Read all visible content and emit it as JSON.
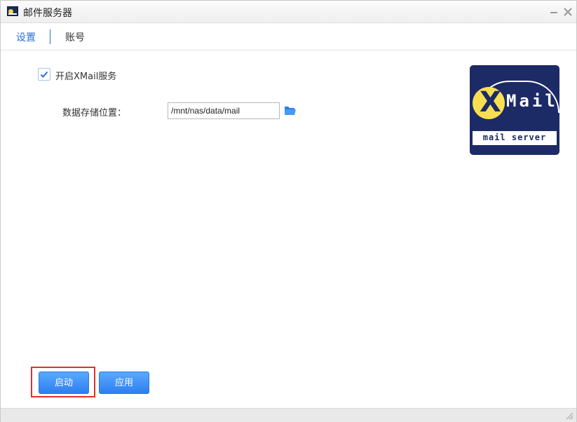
{
  "window": {
    "title": "邮件服务器",
    "app_icon": "xmail-app-icon"
  },
  "titlebar": {
    "minimize_icon": "minimize-icon",
    "close_icon": "close-icon"
  },
  "tabs": [
    {
      "label": "设置",
      "active": true
    },
    {
      "label": "账号",
      "active": false
    }
  ],
  "settings": {
    "enable_label": "开启XMail服务",
    "enable_checked": true,
    "storage_label": "数据存储位置：",
    "storage_value": "/mnt/nas/data/mail",
    "browse_icon": "folder-icon"
  },
  "logo": {
    "letter": "X",
    "word": "Mail",
    "tagline": "mail server"
  },
  "buttons": {
    "start": "启动",
    "apply": "应用"
  },
  "colors": {
    "accent": "#2a6fd6",
    "button": "#3d8ef8",
    "highlight": "#e0302f",
    "logo_bg": "#1c2a66",
    "logo_yellow": "#f8df52"
  }
}
